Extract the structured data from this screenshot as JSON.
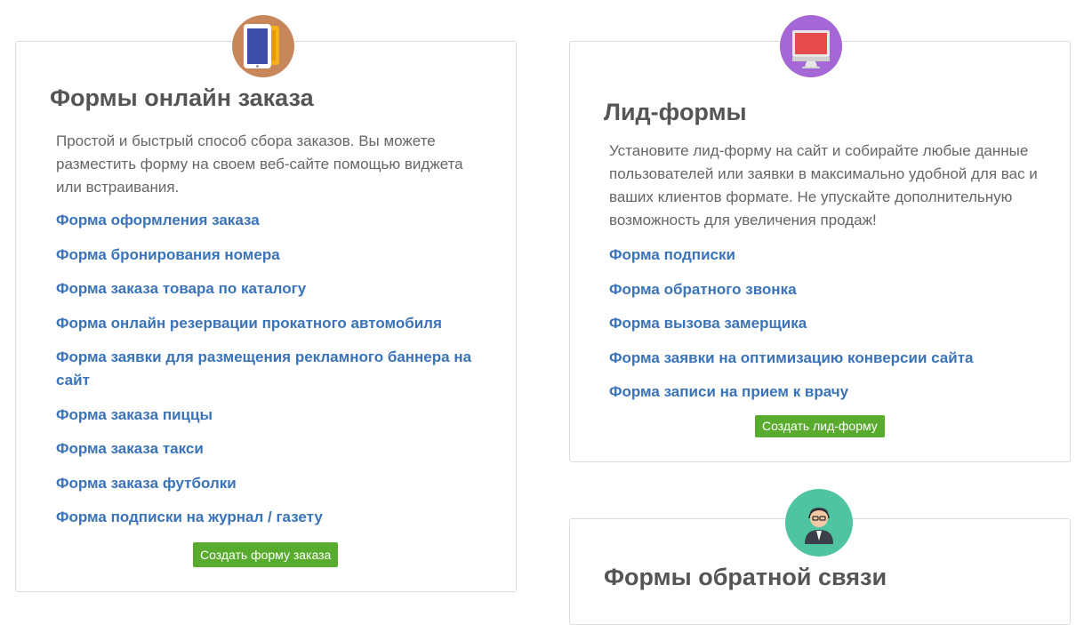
{
  "orders": {
    "icon": "tablet-icon",
    "title": "Формы онлайн заказа",
    "description": "Простой и быстрый способ сбора заказов. Вы можете разместить форму на своем веб-сайте помощью виджета или встраивания.",
    "links": [
      "Форма оформления заказа",
      "Форма бронирования номера",
      "Форма заказа товара по каталогу",
      "Форма онлайн резервации прокатного автомобиля",
      "Форма заявки для размещения рекламного баннера на сайт",
      "Форма заказа пиццы",
      "Форма заказа такси",
      "Форма заказа футболки",
      "Форма подписки на журнал / газету"
    ],
    "button": "Создать форму заказа"
  },
  "lead": {
    "icon": "monitor-icon",
    "title": "Лид-формы",
    "description": "Установите лид-форму на сайт и собирайте любые данные пользователей или заявки в максимально удобной для вас и ваших клиентов формате. Не упускайте дополнительную возможность для увеличения продаж!",
    "links": [
      "Форма подписки",
      "Форма обратного звонка",
      "Форма вызова замерщика",
      "Форма заявки на оптимизацию конверсии сайта",
      "Форма записи на прием к врачу"
    ],
    "button": "Создать лид-форму"
  },
  "feedback": {
    "icon": "support-agent-icon",
    "title": "Формы обратной связи"
  },
  "colors": {
    "link": "#3a73b8",
    "button": "#59ab2e",
    "title": "#555555",
    "text": "#666666"
  }
}
